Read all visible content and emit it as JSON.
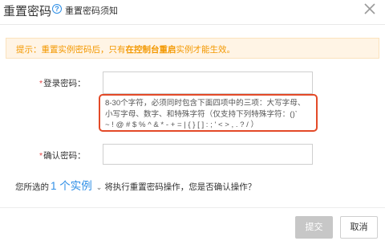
{
  "dialog": {
    "title": "重置密码",
    "help_link": "重置密码须知",
    "help_icon": "?",
    "close_icon": "close-icon"
  },
  "notice": {
    "prefix": "提示：重置实例密码后，只有",
    "emphasis": "在控制台重启",
    "suffix": "实例才能生效。"
  },
  "form": {
    "login_password_label": "登录密码：",
    "confirm_password_label": "确认密码：",
    "required_mark": "*",
    "login_password_value": "",
    "confirm_password_value": "",
    "hint_line1": "8-30个字符，必须同时包含下面四项中的三项：大写字母、",
    "hint_line2": "小写字母、数字、和特殊字符（仅支持下列特殊字符：()`",
    "hint_line3": "~ ! @ # $ % ^ & * - + = | { } [ ] : ; ' < > , . ? / ）"
  },
  "summary": {
    "prefix": "您所选的",
    "instances": "1 个实例",
    "caret": "⌄",
    "suffix": "将执行重置密码操作，您是否确认操作？"
  },
  "footer": {
    "submit_label": "提交",
    "cancel_label": "取消"
  },
  "colors": {
    "accent": "#2f8fe6",
    "notice_text": "#f39800",
    "notice_bg": "#fff4e5",
    "hint_border": "#e34a28",
    "required": "#e54545",
    "submit_disabled": "#c7c7c7"
  }
}
